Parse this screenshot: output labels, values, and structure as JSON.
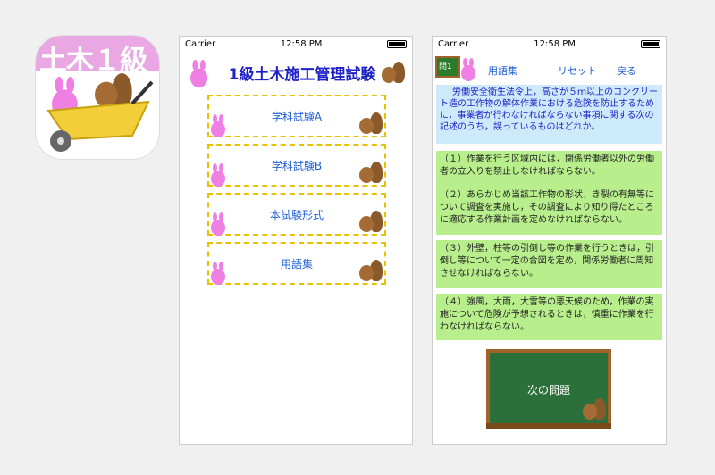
{
  "app_icon": {
    "title": "土木１級"
  },
  "status_bar": {
    "carrier": "Carrier",
    "time": "12:58 PM"
  },
  "screen1": {
    "title": "1級土木施工管理試験",
    "menu": [
      {
        "label": "学科試験A"
      },
      {
        "label": "学科試験B"
      },
      {
        "label": "本試験形式"
      },
      {
        "label": "用語集"
      }
    ]
  },
  "screen2": {
    "question_badge": "問1",
    "nav": {
      "glossary": "用語集",
      "reset": "リセット",
      "back": "戻る"
    },
    "question": "労働安全衛生法令上，高さが５ｍ以上のコンクリート造の工作物の解体作業における危険を防止するために，事業者が行わなければならない事項に関する次の記述のうち，誤っているものはどれか。",
    "answers": [
      {
        "text": "（１）作業を行う区域内には，関係労働者以外の労働者の立入りを禁止しなければならない。"
      },
      {
        "text": "（２）あらかじめ当該工作物の形状，き裂の有無等について調査を実施し，その調査により知り得たところに適応する作業計画を定めなければならない。"
      },
      {
        "text": "（３）外壁，柱等の引倒し等の作業を行うときは，引倒し等について一定の合図を定め，関係労働者に周知させなければならない。"
      },
      {
        "text": "（４）強風，大雨，大雪等の悪天候のため，作業の実施について危険が予想されるときは，慎重に作業を行わなければならない。"
      }
    ],
    "next_button": "次の問題"
  }
}
